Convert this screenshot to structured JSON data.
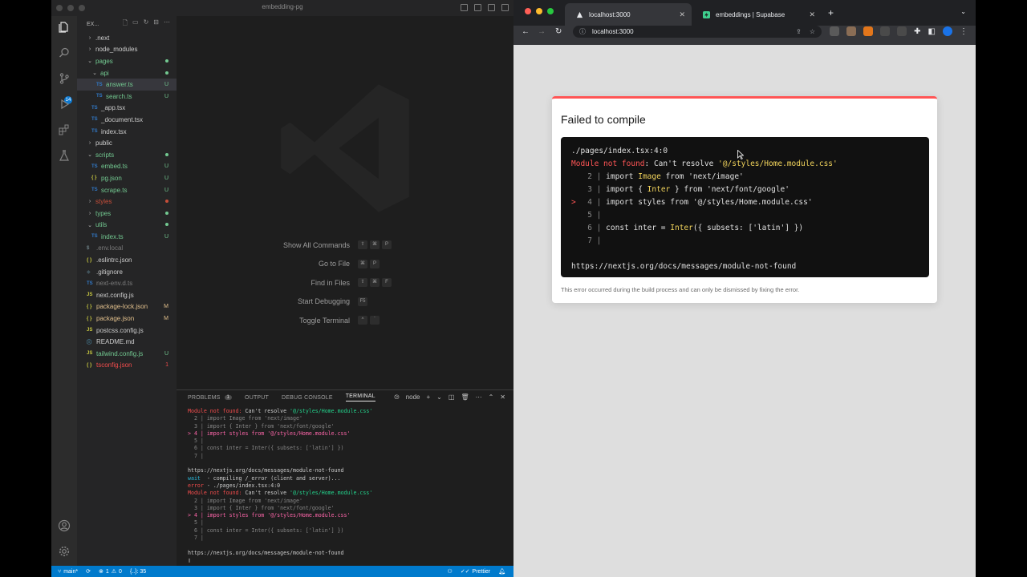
{
  "vscode": {
    "window_title": "embedding-pg",
    "explorer": {
      "header": "EX...",
      "items": [
        {
          "label": ".next",
          "type": "folder",
          "status": "",
          "status_color": "",
          "indent": 1
        },
        {
          "label": "node_modules",
          "type": "folder",
          "status": "",
          "status_color": "",
          "indent": 1
        },
        {
          "label": "pages",
          "type": "folder-open",
          "status": "dot",
          "status_color": "#73c991",
          "indent": 1
        },
        {
          "label": "api",
          "type": "folder-open",
          "status": "dot",
          "status_color": "#73c991",
          "indent": 2
        },
        {
          "label": "answer.ts",
          "type": "ts",
          "status": "U",
          "status_color": "#73c991",
          "indent": 3,
          "selected": true
        },
        {
          "label": "search.ts",
          "type": "ts",
          "status": "U",
          "status_color": "#73c991",
          "indent": 3
        },
        {
          "label": "_app.tsx",
          "type": "ts",
          "status": "",
          "status_color": "",
          "indent": 2
        },
        {
          "label": "_document.tsx",
          "type": "ts",
          "status": "",
          "status_color": "",
          "indent": 2
        },
        {
          "label": "index.tsx",
          "type": "ts",
          "status": "",
          "status_color": "",
          "indent": 2
        },
        {
          "label": "public",
          "type": "folder",
          "status": "",
          "status_color": "",
          "indent": 1
        },
        {
          "label": "scripts",
          "type": "folder-open",
          "status": "dot",
          "status_color": "#73c991",
          "indent": 1
        },
        {
          "label": "embed.ts",
          "type": "ts",
          "status": "U",
          "status_color": "#73c991",
          "indent": 2
        },
        {
          "label": "pg.json",
          "type": "json",
          "status": "U",
          "status_color": "#73c991",
          "indent": 2
        },
        {
          "label": "scrape.ts",
          "type": "ts",
          "status": "U",
          "status_color": "#73c991",
          "indent": 2
        },
        {
          "label": "styles",
          "type": "folder",
          "status": "dot",
          "status_color": "#c74e39",
          "indent": 1
        },
        {
          "label": "types",
          "type": "folder",
          "status": "dot",
          "status_color": "#73c991",
          "indent": 1
        },
        {
          "label": "utils",
          "type": "folder-open",
          "status": "dot",
          "status_color": "#73c991",
          "indent": 1
        },
        {
          "label": "index.ts",
          "type": "ts",
          "status": "U",
          "status_color": "#73c991",
          "indent": 2
        },
        {
          "label": ".env.local",
          "type": "env",
          "status": "",
          "status_color": "",
          "indent": 1,
          "dim": true
        },
        {
          "label": ".eslintrc.json",
          "type": "json",
          "status": "",
          "status_color": "",
          "indent": 1
        },
        {
          "label": ".gitignore",
          "type": "git",
          "status": "",
          "status_color": "",
          "indent": 1
        },
        {
          "label": "next-env.d.ts",
          "type": "ts",
          "status": "",
          "status_color": "",
          "indent": 1,
          "dim": true
        },
        {
          "label": "next.config.js",
          "type": "js",
          "status": "",
          "status_color": "",
          "indent": 1
        },
        {
          "label": "package-lock.json",
          "type": "json",
          "status": "M",
          "status_color": "#e2c08d",
          "indent": 1
        },
        {
          "label": "package.json",
          "type": "json",
          "status": "M",
          "status_color": "#e2c08d",
          "indent": 1
        },
        {
          "label": "postcss.config.js",
          "type": "js",
          "status": "",
          "status_color": "",
          "indent": 1
        },
        {
          "label": "README.md",
          "type": "md",
          "status": "",
          "status_color": "",
          "indent": 1
        },
        {
          "label": "tailwind.config.js",
          "type": "js",
          "status": "U",
          "status_color": "#73c991",
          "indent": 1
        },
        {
          "label": "tsconfig.json",
          "type": "json",
          "status": "1",
          "status_color": "#f14c4c",
          "indent": 1,
          "error": true
        }
      ]
    },
    "activity_badge": "14",
    "shortcuts": [
      {
        "label": "Show All Commands",
        "keys": [
          "⇧",
          "⌘",
          "P"
        ]
      },
      {
        "label": "Go to File",
        "keys": [
          "⌘",
          "P"
        ]
      },
      {
        "label": "Find in Files",
        "keys": [
          "⇧",
          "⌘",
          "F"
        ]
      },
      {
        "label": "Start Debugging",
        "keys": [
          "F5"
        ]
      },
      {
        "label": "Toggle Terminal",
        "keys": [
          "^",
          "`"
        ]
      }
    ],
    "panel": {
      "tabs": {
        "problems": "PROBLEMS",
        "problems_count": "1",
        "output": "OUTPUT",
        "debug": "DEBUG CONSOLE",
        "terminal": "TERMINAL"
      },
      "terminal_name": "node"
    },
    "terminal": {
      "block1": {
        "header_a": "Module not found:",
        "header_b": " Can't resolve ",
        "header_c": "'@/styles/Home.module.css'",
        "l2": "  2 | import Image from 'next/image'",
        "l3": "  3 | import { Inter } from 'next/font/google'",
        "l4": "> 4 | import styles from '@/styles/Home.module.css'",
        "l5": "  5 |",
        "l6": "  6 | const inter = Inter({ subsets: ['latin'] })",
        "l7": "  7 |"
      },
      "url1": "https://nextjs.org/docs/messages/module-not-found",
      "wait_kw": "wait",
      "wait_text": "  - compiling /_error (client and server)...",
      "error_kw": "error",
      "error_text": " - ./pages/index.tsx:4:0",
      "url2": "https://nextjs.org/docs/messages/module-not-found"
    },
    "status": {
      "branch": "main*",
      "errors": "1",
      "warnings": "0",
      "bracket": "{..}: 35",
      "prettier": "Prettier"
    }
  },
  "chrome": {
    "tabs": [
      {
        "title": "localhost:3000",
        "active": true
      },
      {
        "title": "embeddings | Supabase",
        "active": false
      }
    ],
    "url": "localhost:3000",
    "error": {
      "title": "Failed to compile",
      "file": "./pages/index.tsx:4:0",
      "module_kw": "Module not found",
      "resolve_text": ": Can't resolve ",
      "resolve_path": "'@/styles/Home.module.css'",
      "code_lines": [
        {
          "marker": " ",
          "num": "2",
          "code_a": "import ",
          "code_b": "Image",
          "code_c": " from 'next/image'"
        },
        {
          "marker": " ",
          "num": "3",
          "code_a": "import { ",
          "code_b": "Inter",
          "code_c": " } from 'next/font/google'"
        },
        {
          "marker": ">",
          "num": "4",
          "code_a": "import styles from ",
          "code_b": "",
          "code_c": "'@/styles/Home.module.css'"
        },
        {
          "marker": " ",
          "num": "5",
          "code_a": "",
          "code_b": "",
          "code_c": ""
        },
        {
          "marker": " ",
          "num": "6",
          "code_a": "const inter = ",
          "code_b": "Inter",
          "code_c": "({ subsets: ['latin'] })"
        },
        {
          "marker": " ",
          "num": "7",
          "code_a": "",
          "code_b": "",
          "code_c": ""
        }
      ],
      "doc_url": "https://nextjs.org/docs/messages/module-not-found",
      "footer": "This error occurred during the build process and can only be dismissed by fixing the error."
    }
  }
}
